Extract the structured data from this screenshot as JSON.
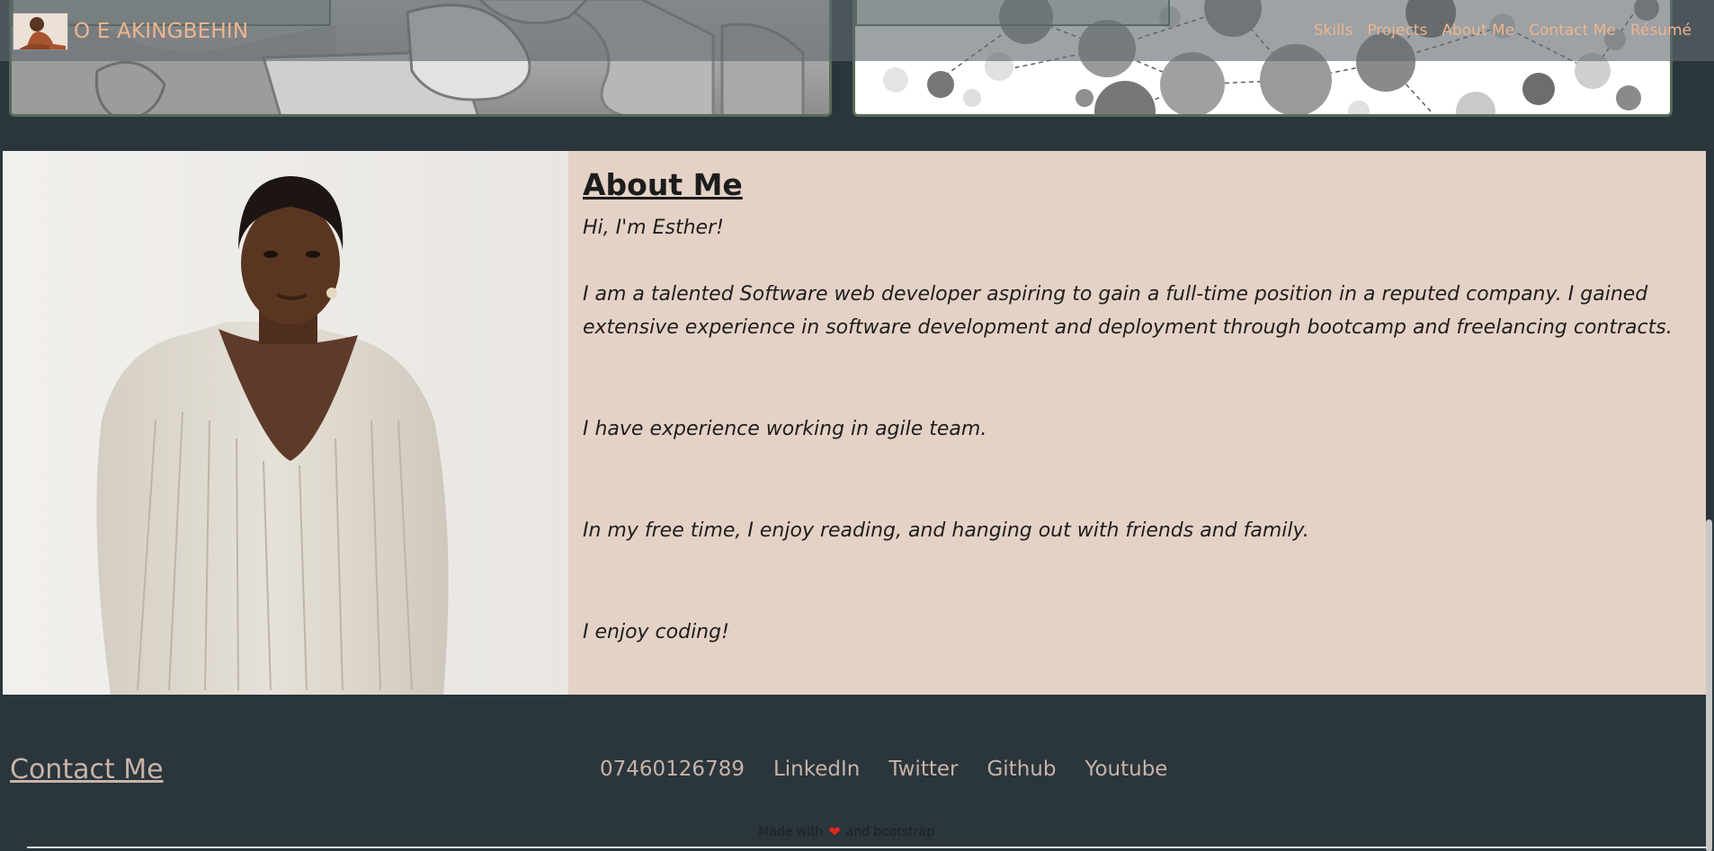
{
  "brand": {
    "name": "O E AKINGBEHIN"
  },
  "nav": {
    "links": [
      "Skills",
      "Projects",
      "About Me",
      "Contact Me",
      "Résumé"
    ]
  },
  "about": {
    "heading": "About Me",
    "greeting": "Hi, I'm Esther!",
    "intro": "I am a talented Software web developer aspiring to gain a full-time position in a reputed company. I gained extensive experience in software development and deployment through bootcamp and freelancing contracts.",
    "agile": "I have experience working in agile team.",
    "free_time": "In my free time, I enjoy reading, and hanging out with friends and family.",
    "coding": "I enjoy coding!"
  },
  "contact": {
    "title": "Contact Me",
    "links": [
      "07460126789",
      "LinkedIn",
      "Twitter",
      "Github",
      "Youtube"
    ]
  },
  "footer": {
    "made_with": "Made with",
    "and": "and bootstrap"
  },
  "colors": {
    "page_bg": "#2a353c",
    "about_bg": "#e5d2c6",
    "accent": "#f0b48c",
    "contact_text": "#c8b3a7",
    "heart": "#e0261b"
  }
}
